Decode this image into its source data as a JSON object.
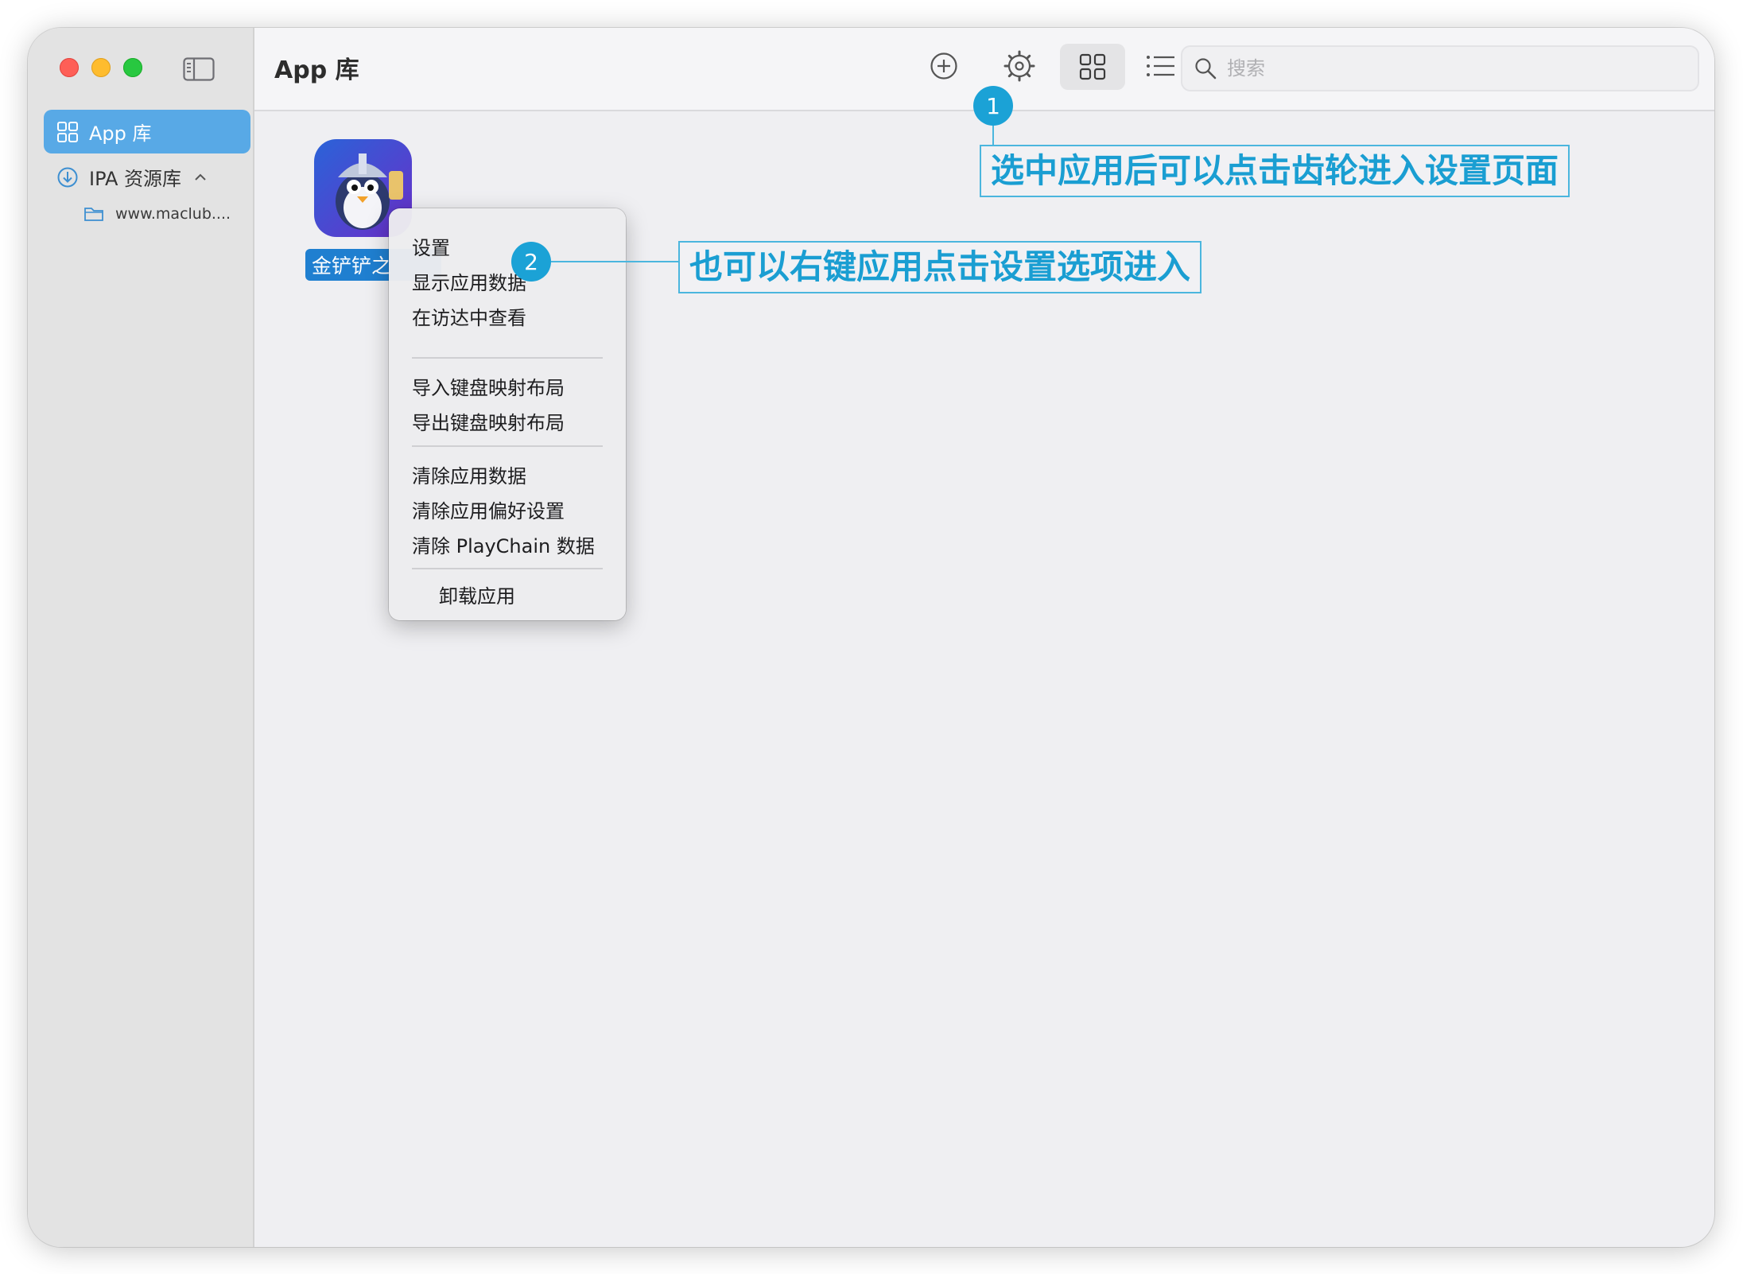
{
  "window": {
    "title": "App 库"
  },
  "sidebar": {
    "items": [
      {
        "label": "App 库",
        "icon": "grid-icon",
        "active": true
      },
      {
        "label": "IPA 资源库",
        "icon": "download-circle-icon",
        "expanded": true
      }
    ],
    "sub_items": [
      {
        "label": "www.maclub....",
        "icon": "folder-icon"
      }
    ]
  },
  "toolbar": {
    "add_icon": "plus-circle-icon",
    "settings_icon": "gear-icon",
    "grid_view_icon": "grid-view-icon",
    "list_view_icon": "list-view-icon",
    "search_placeholder": "搜索"
  },
  "apps": [
    {
      "name": "金铲铲之"
    }
  ],
  "context_menu": {
    "groups": [
      [
        "设置",
        "显示应用数据",
        "在访达中查看"
      ],
      [
        "导入键盘映射布局",
        "导出键盘映射布局"
      ],
      [
        "清除应用数据",
        "清除应用偏好设置",
        "清除 PlayChain 数据"
      ],
      [
        "卸载应用"
      ]
    ]
  },
  "annotations": [
    {
      "number": "1",
      "text": "选中应用后可以点击齿轮进入设置页面"
    },
    {
      "number": "2",
      "text": "也可以右键应用点击设置选项进入"
    }
  ],
  "colors": {
    "accent": "#58a9e6",
    "annotation": "#1a9ed2",
    "traffic_red": "#fe5f57",
    "traffic_yellow": "#febc2e",
    "traffic_green": "#28c840"
  }
}
